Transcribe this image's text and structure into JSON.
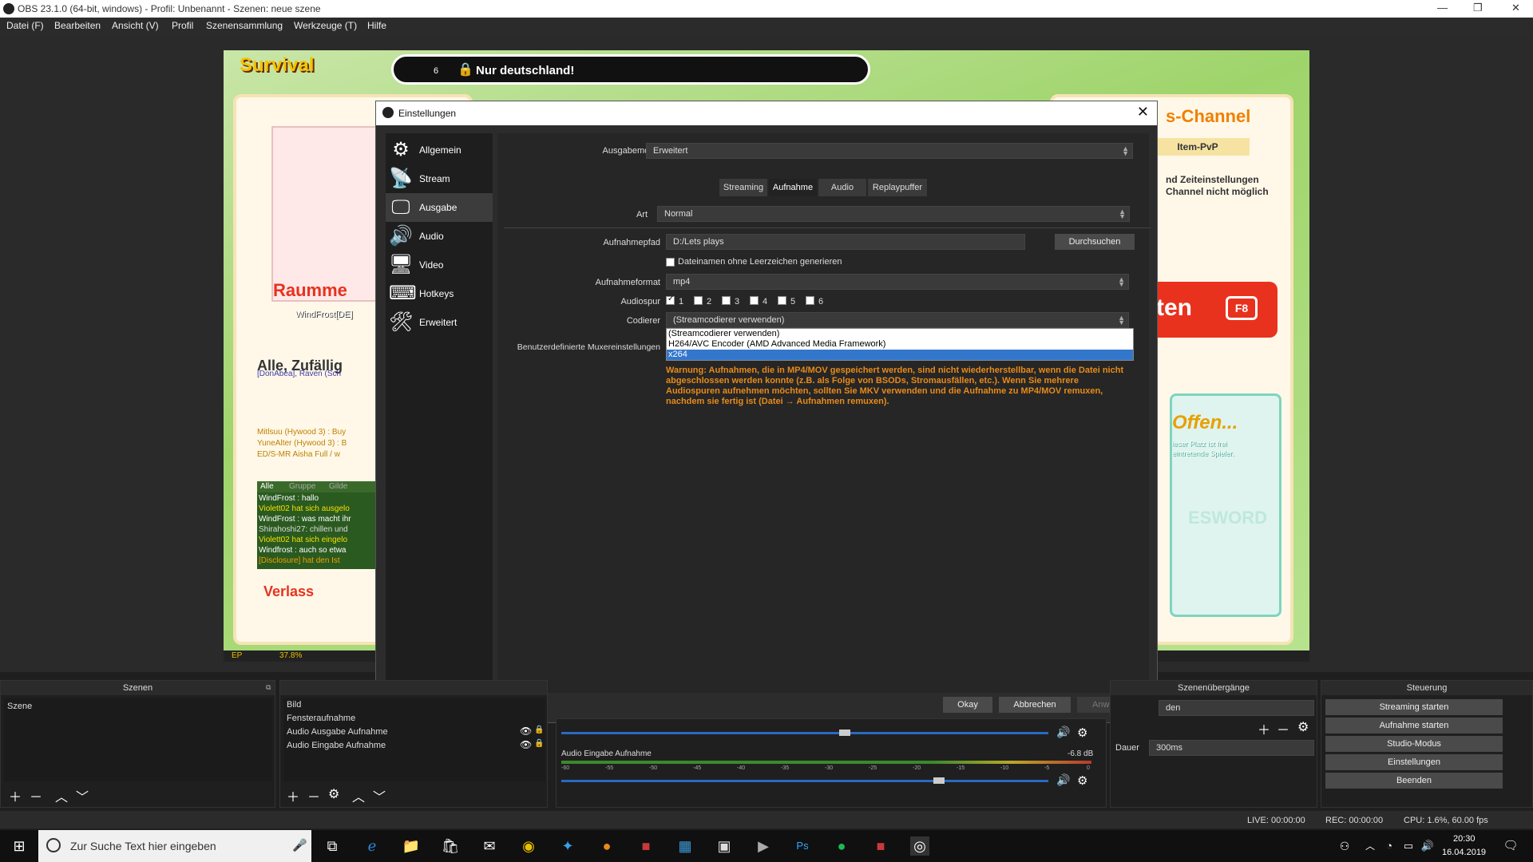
{
  "window": {
    "title": "OBS 23.1.0 (64-bit, windows) - Profil: Unbenannt - Szenen: neue szene",
    "minimize": "—",
    "maximize": "❐",
    "close": "✕"
  },
  "menu": [
    "Datei (F)",
    "Bearbeiten",
    "Ansicht (V)",
    "Profil",
    "Szenensammlung",
    "Werkzeuge (T)",
    "Hilfe"
  ],
  "game": {
    "title": "Survival",
    "banner_num": "6",
    "banner_text": "Nur deutschland!",
    "channel": "s-Channel",
    "itempvp": "Item-PvP",
    "notice1": "nd Zeiteinstellungen",
    "notice2": "Channel nicht möglich",
    "start": "ten",
    "fkey": "F8",
    "raum": "Raumme",
    "player": "WindFrost[DE]",
    "mode": "Alle, Zufällig",
    "offen": "Offen...",
    "free1": "ieser Platz ist frei",
    "free2": "eintretende Spieler.",
    "logo": "ESWORD",
    "ep_label": "EP",
    "ep_value": "37.8%",
    "verlass": "Verlass",
    "chat_tabs": [
      "Alle",
      "Gruppe",
      "Gilde"
    ],
    "chat": [
      "WindFrost : hallo",
      "Violett02 hat sich ausgelo",
      "WindFrost : was macht ihr",
      "Shirahoshi27: chillen und",
      "Violett02 hat sich eingelo",
      "Windfrost : auch so etwa",
      "[Disclosure] hat den Ist"
    ],
    "chat_top": [
      "[DonAbea], Raven (Sch",
      "Mitlsuu (Hywood 3) : Buy",
      "YuneAlter (Hywood 3) : B",
      "ED/S-MR Aisha Full / w"
    ]
  },
  "dialog": {
    "title": "Einstellungen",
    "close": "✕",
    "nav": [
      {
        "label": "Allgemein",
        "icon": "gear-icon",
        "glyph": "⚙"
      },
      {
        "label": "Stream",
        "icon": "antenna-icon",
        "glyph": "📡"
      },
      {
        "label": "Ausgabe",
        "icon": "monitor-output-icon",
        "glyph": "🖵"
      },
      {
        "label": "Audio",
        "icon": "speaker-icon",
        "glyph": "🔊"
      },
      {
        "label": "Video",
        "icon": "display-icon",
        "glyph": "🖥"
      },
      {
        "label": "Hotkeys",
        "icon": "keyboard-icon",
        "glyph": "⌨"
      },
      {
        "label": "Erweitert",
        "icon": "tools-icon",
        "glyph": "🛠"
      }
    ],
    "output_mode_label": "Ausgabemodus",
    "output_mode": "Erweitert",
    "tabs": [
      "Streaming",
      "Aufnahme",
      "Audio",
      "Replaypuffer"
    ],
    "art_label": "Art",
    "art": "Normal",
    "path_label": "Aufnahmepfad",
    "path": "D:/Lets plays",
    "browse": "Durchsuchen",
    "nospace_label": "Dateinamen ohne Leerzeichen generieren",
    "format_label": "Aufnahmeformat",
    "format": "mp4",
    "tracks_label": "Audiospur",
    "tracks": [
      "1",
      "2",
      "3",
      "4",
      "5",
      "6"
    ],
    "encoder_label": "Codierer",
    "encoder": "(Streamcodierer verwenden)",
    "encoder_options": [
      "(Streamcodierer verwenden)",
      "H264/AVC Encoder (AMD Advanced Media Framework)",
      "x264"
    ],
    "muxer_label": "Benutzerdefinierte Muxereinstellungen",
    "warning": "Warnung: Aufnahmen, die in MP4/MOV gespeichert werden, sind nicht wiederherstellbar, wenn die Datei nicht abgeschlossen werden konnte (z.B. als Folge von BSODs, Stromausfällen, etc.). Wenn Sie mehrere Audiospuren aufnehmen möchten, sollten Sie MKV verwenden und die Aufnahme zu MP4/MOV remuxen, nachdem sie fertig ist (Datei → Aufnahmen remuxen).",
    "ok": "Okay",
    "cancel": "Abbrechen",
    "apply": "Anwenden"
  },
  "scenes": {
    "header": "Szenen",
    "items": [
      "Szene"
    ]
  },
  "sources": {
    "header": "",
    "items": [
      "Bild",
      "Fensteraufnahme",
      "Audio Ausgabe Aufnahme",
      "Audio Eingabe Aufnahme"
    ]
  },
  "mixer": {
    "input_label": "Audio Eingabe Aufnahme",
    "input_db": "-6.8 dB",
    "scale": [
      "-60",
      "-55",
      "-50",
      "-45",
      "-40",
      "-35",
      "-30",
      "-25",
      "-20",
      "-15",
      "-10",
      "-5",
      "0"
    ],
    "input_level": 0.72,
    "output_level": 0.52
  },
  "transitions": {
    "header": "Szenenübergänge",
    "value": "den",
    "duration_label": "Dauer",
    "duration": "300ms"
  },
  "controls": {
    "header": "Steuerung",
    "buttons": [
      "Streaming starten",
      "Aufnahme starten",
      "Studio-Modus",
      "Einstellungen",
      "Beenden"
    ]
  },
  "status": {
    "live": "LIVE: 00:00:00",
    "rec": "REC: 00:00:00",
    "cpu": "CPU: 1.6%, 60.00 fps"
  },
  "taskbar": {
    "search": "Zur Suche Text hier eingeben",
    "time": "20:30",
    "date": "16.04.2019"
  }
}
